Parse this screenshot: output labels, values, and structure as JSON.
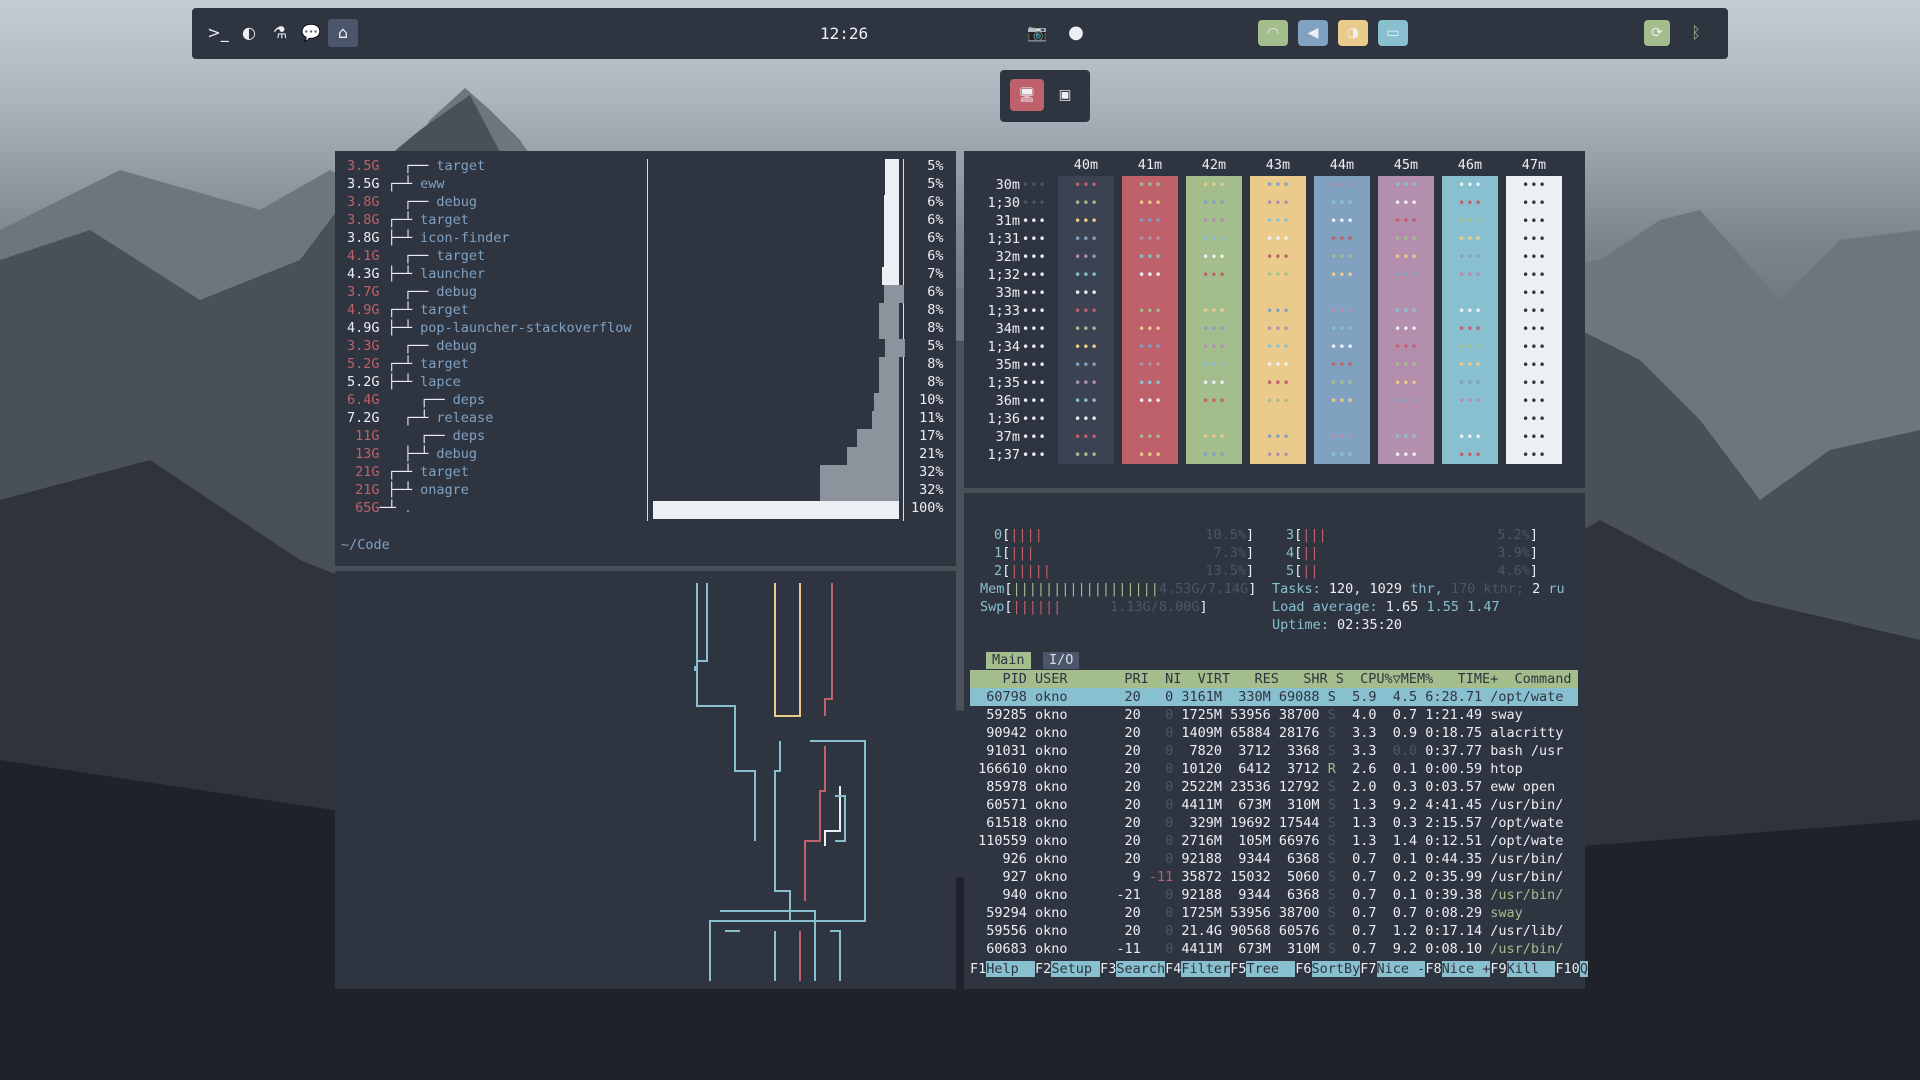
{
  "topbar": {
    "left_icons": [
      "terminal-icon",
      "moon-icon",
      "flask-icon",
      "chat-icon",
      "home-icon"
    ],
    "clock": "12:26",
    "center_icons": [
      "camera-icon",
      "record-icon"
    ],
    "status_icons": [
      "wifi-icon",
      "volume-icon",
      "brightness-icon",
      "battery-icon"
    ],
    "tray_icons": [
      "sync-icon",
      "bluetooth-icon"
    ],
    "colors": {
      "wifi": "#a3be8c",
      "volume": "#81a1c1",
      "brightness": "#ebcb8b",
      "battery": "#88c0d0",
      "sync": "#a3be8c"
    }
  },
  "workspaces": {
    "icons": [
      "monitor-icon",
      "screenshot-icon"
    ],
    "active_color": "#bf616a"
  },
  "dust": {
    "rows": [
      {
        "size": "3.5G",
        "name": "target",
        "tree": "   ┌──",
        "red": true,
        "pct": "5%",
        "fill": 0
      },
      {
        "size": "3.5G",
        "name": "eww",
        "tree": " ┌─┴",
        "red": false,
        "pct": "5%",
        "fill": 0
      },
      {
        "size": "3.8G",
        "name": "debug",
        "tree": "   ┌──",
        "red": true,
        "pct": "6%",
        "fill": 0
      },
      {
        "size": "3.8G",
        "name": "target",
        "tree": " ┌─┴",
        "red": true,
        "pct": "6%",
        "fill": 0
      },
      {
        "size": "3.8G",
        "name": "icon-finder",
        "tree": " ├─┴",
        "red": false,
        "pct": "6%",
        "fill": 0
      },
      {
        "size": "4.1G",
        "name": "target",
        "tree": "   ┌──",
        "red": true,
        "pct": "6%",
        "fill": 0
      },
      {
        "size": "4.3G",
        "name": "launcher",
        "tree": " ├─┴",
        "red": false,
        "pct": "7%",
        "fill": 0
      },
      {
        "size": "3.7G",
        "name": "debug",
        "tree": "   ┌──",
        "red": true,
        "pct": "6%",
        "fill": 8
      },
      {
        "size": "4.9G",
        "name": "target",
        "tree": " ┌─┴",
        "red": true,
        "pct": "8%",
        "fill": 8
      },
      {
        "size": "4.9G",
        "name": "pop-launcher-stackoverflow",
        "tree": " ├─┴",
        "red": false,
        "pct": "8%",
        "fill": 8
      },
      {
        "size": "3.3G",
        "name": "debug",
        "tree": "   ┌──",
        "red": true,
        "pct": "5%",
        "fill": 8
      },
      {
        "size": "5.2G",
        "name": "target",
        "tree": " ┌─┴",
        "red": true,
        "pct": "8%",
        "fill": 8
      },
      {
        "size": "5.2G",
        "name": "lapce",
        "tree": " ├─┴",
        "red": false,
        "pct": "8%",
        "fill": 8
      },
      {
        "size": "6.4G",
        "name": "deps",
        "tree": "     ┌──",
        "red": true,
        "pct": "10%",
        "fill": 10
      },
      {
        "size": "7.2G",
        "name": "release",
        "tree": "   ┌─┴",
        "red": false,
        "pct": "11%",
        "fill": 11
      },
      {
        "size": "11G",
        "name": "deps",
        "tree": "     ┌──",
        "red": true,
        "pct": "17%",
        "fill": 17
      },
      {
        "size": "13G",
        "name": "debug",
        "tree": "   ├─┴",
        "red": true,
        "pct": "21%",
        "fill": 21
      },
      {
        "size": "21G",
        "name": "target",
        "tree": " ┌─┴",
        "red": true,
        "pct": "32%",
        "fill": 32
      },
      {
        "size": "21G",
        "name": "onagre",
        "tree": " ├─┴",
        "red": true,
        "pct": "32%",
        "fill": 32
      },
      {
        "size": "65G",
        "name": ".",
        "tree": "─┴",
        "red": true,
        "pct": "100%",
        "fill": 100
      }
    ],
    "cwd": "~/Code"
  },
  "clock_grid": {
    "columns": [
      "40m",
      "41m",
      "42m",
      "43m",
      "44m",
      "45m",
      "46m",
      "47m"
    ],
    "rows": [
      "30m",
      "1;30",
      "31m",
      "1;31",
      "32m",
      "1;32",
      "33m",
      "1;33",
      "34m",
      "1;34",
      "35m",
      "1;35",
      "36m",
      "1;36",
      "37m",
      "1;37"
    ],
    "column_colors": [
      "#3b4252",
      "#bf616a",
      "#a3be8c",
      "#ebcb8b",
      "#81a1c1",
      "#b48ead",
      "#88c0d0",
      "#eceff4"
    ]
  },
  "htop": {
    "cpus": [
      {
        "id": "0",
        "bars": "||||",
        "val": "10.5%"
      },
      {
        "id": "1",
        "bars": "|||",
        "val": "7.3%"
      },
      {
        "id": "2",
        "bars": "|||||",
        "val": "13.5%"
      },
      {
        "id": "3",
        "bars": "|||",
        "val": "5.2%"
      },
      {
        "id": "4",
        "bars": "||",
        "val": "3.9%"
      },
      {
        "id": "5",
        "bars": "||",
        "val": "4.6%"
      }
    ],
    "mem": {
      "label": "Mem",
      "bars": "||||||||||||||||||",
      "val": "4.53G/7.14G"
    },
    "swp": {
      "label": "Swp",
      "bars": "||||||",
      "val": "1.13G/8.00G"
    },
    "tasks": {
      "label": "Tasks:",
      "tasks": "120,",
      "thr": "1029",
      "thr_label": "thr,",
      "kthr": "170",
      "kthr_label": "kthr;",
      "running": "2",
      "running_label": "ru"
    },
    "load": {
      "label": "Load average:",
      "v1": "1.65",
      "v2": "1.55",
      "v3": "1.47"
    },
    "uptime": {
      "label": "Uptime:",
      "value": "02:35:20"
    },
    "tabs": [
      "Main",
      "I/O"
    ],
    "header": "    PID USER       PRI  NI  VIRT   RES   SHR S  CPU%▽MEM%   TIME+  Command",
    "processes": [
      {
        "pid": "60798",
        "user": "okno",
        "pri": "20",
        "ni": "0",
        "virt": "3161M",
        "res": "330M",
        "shr": "69088",
        "s": "S",
        "cpu": "5.9",
        "mem": "4.5",
        "time": "6:28.71",
        "cmd": "/opt/wate"
      },
      {
        "pid": "59285",
        "user": "okno",
        "pri": "20",
        "ni": "0",
        "virt": "1725M",
        "res": "53956",
        "shr": "38700",
        "s": "S",
        "cpu": "4.0",
        "mem": "0.7",
        "time": "1:21.49",
        "cmd": "sway"
      },
      {
        "pid": "90942",
        "user": "okno",
        "pri": "20",
        "ni": "0",
        "virt": "1409M",
        "res": "65884",
        "shr": "28176",
        "s": "S",
        "cpu": "3.3",
        "mem": "0.9",
        "time": "0:18.75",
        "cmd": "alacritty"
      },
      {
        "pid": "91031",
        "user": "okno",
        "pri": "20",
        "ni": "0",
        "virt": "7820",
        "res": "3712",
        "shr": "3368",
        "s": "S",
        "cpu": "3.3",
        "mem": "0.0",
        "time": "0:37.77",
        "cmd": "bash /usr"
      },
      {
        "pid": "166610",
        "user": "okno",
        "pri": "20",
        "ni": "0",
        "virt": "10120",
        "res": "6412",
        "shr": "3712",
        "s": "R",
        "cpu": "2.6",
        "mem": "0.1",
        "time": "0:00.59",
        "cmd": "htop"
      },
      {
        "pid": "85978",
        "user": "okno",
        "pri": "20",
        "ni": "0",
        "virt": "2522M",
        "res": "23536",
        "shr": "12792",
        "s": "S",
        "cpu": "2.0",
        "mem": "0.3",
        "time": "0:03.57",
        "cmd": "eww open"
      },
      {
        "pid": "60571",
        "user": "okno",
        "pri": "20",
        "ni": "0",
        "virt": "4411M",
        "res": "673M",
        "shr": "310M",
        "s": "S",
        "cpu": "1.3",
        "mem": "9.2",
        "time": "4:41.45",
        "cmd": "/usr/bin/"
      },
      {
        "pid": "61518",
        "user": "okno",
        "pri": "20",
        "ni": "0",
        "virt": "329M",
        "res": "19692",
        "shr": "17544",
        "s": "S",
        "cpu": "1.3",
        "mem": "0.3",
        "time": "2:15.57",
        "cmd": "/opt/wate"
      },
      {
        "pid": "110559",
        "user": "okno",
        "pri": "20",
        "ni": "0",
        "virt": "2716M",
        "res": "105M",
        "shr": "66976",
        "s": "S",
        "cpu": "1.3",
        "mem": "1.4",
        "time": "0:12.51",
        "cmd": "/opt/wate"
      },
      {
        "pid": "926",
        "user": "okno",
        "pri": "20",
        "ni": "0",
        "virt": "92188",
        "res": "9344",
        "shr": "6368",
        "s": "S",
        "cpu": "0.7",
        "mem": "0.1",
        "time": "0:44.35",
        "cmd": "/usr/bin/"
      },
      {
        "pid": "927",
        "user": "okno",
        "pri": "9",
        "ni": "-11",
        "virt": "35872",
        "res": "15032",
        "shr": "5060",
        "s": "S",
        "cpu": "0.7",
        "mem": "0.2",
        "time": "0:35.99",
        "cmd": "/usr/bin/"
      },
      {
        "pid": "940",
        "user": "okno",
        "pri": "-21",
        "ni": "0",
        "virt": "92188",
        "res": "9344",
        "shr": "6368",
        "s": "S",
        "cpu": "0.7",
        "mem": "0.1",
        "time": "0:39.38",
        "cmd": "/usr/bin/"
      },
      {
        "pid": "59294",
        "user": "okno",
        "pri": "20",
        "ni": "0",
        "virt": "1725M",
        "res": "53956",
        "shr": "38700",
        "s": "S",
        "cpu": "0.7",
        "mem": "0.7",
        "time": "0:08.29",
        "cmd": "sway"
      },
      {
        "pid": "59556",
        "user": "okno",
        "pri": "20",
        "ni": "0",
        "virt": "21.4G",
        "res": "90568",
        "shr": "60576",
        "s": "S",
        "cpu": "0.7",
        "mem": "1.2",
        "time": "0:17.14",
        "cmd": "/usr/lib/"
      },
      {
        "pid": "60683",
        "user": "okno",
        "pri": "-11",
        "ni": "0",
        "virt": "4411M",
        "res": "673M",
        "shr": "310M",
        "s": "S",
        "cpu": "0.7",
        "mem": "9.2",
        "time": "0:08.10",
        "cmd": "/usr/bin/"
      }
    ],
    "fkeys": [
      {
        "k": "F1",
        "l": "Help  "
      },
      {
        "k": "F2",
        "l": "Setup "
      },
      {
        "k": "F3",
        "l": "Search"
      },
      {
        "k": "F4",
        "l": "Filter"
      },
      {
        "k": "F5",
        "l": "Tree  "
      },
      {
        "k": "F6",
        "l": "SortBy"
      },
      {
        "k": "F7",
        "l": "Nice -"
      },
      {
        "k": "F8",
        "l": "Nice +"
      },
      {
        "k": "F9",
        "l": "Kill  "
      },
      {
        "k": "F10",
        "l": "Q"
      }
    ]
  }
}
